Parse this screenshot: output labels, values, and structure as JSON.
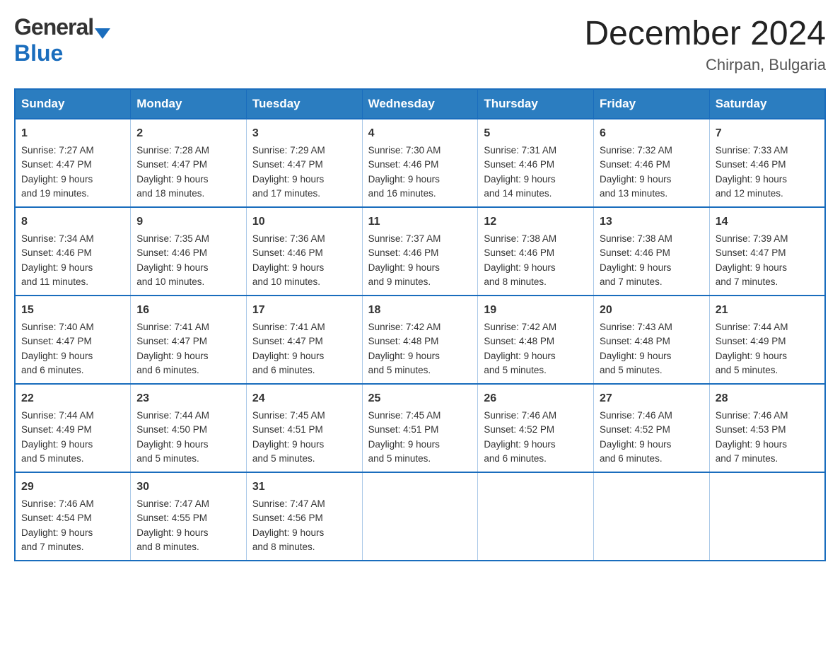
{
  "header": {
    "logo_general": "General",
    "logo_blue": "Blue",
    "month_title": "December 2024",
    "location": "Chirpan, Bulgaria"
  },
  "days_of_week": [
    "Sunday",
    "Monday",
    "Tuesday",
    "Wednesday",
    "Thursday",
    "Friday",
    "Saturday"
  ],
  "weeks": [
    [
      {
        "day": "1",
        "sunrise": "7:27 AM",
        "sunset": "4:47 PM",
        "daylight": "9 hours and 19 minutes."
      },
      {
        "day": "2",
        "sunrise": "7:28 AM",
        "sunset": "4:47 PM",
        "daylight": "9 hours and 18 minutes."
      },
      {
        "day": "3",
        "sunrise": "7:29 AM",
        "sunset": "4:47 PM",
        "daylight": "9 hours and 17 minutes."
      },
      {
        "day": "4",
        "sunrise": "7:30 AM",
        "sunset": "4:46 PM",
        "daylight": "9 hours and 16 minutes."
      },
      {
        "day": "5",
        "sunrise": "7:31 AM",
        "sunset": "4:46 PM",
        "daylight": "9 hours and 14 minutes."
      },
      {
        "day": "6",
        "sunrise": "7:32 AM",
        "sunset": "4:46 PM",
        "daylight": "9 hours and 13 minutes."
      },
      {
        "day": "7",
        "sunrise": "7:33 AM",
        "sunset": "4:46 PM",
        "daylight": "9 hours and 12 minutes."
      }
    ],
    [
      {
        "day": "8",
        "sunrise": "7:34 AM",
        "sunset": "4:46 PM",
        "daylight": "9 hours and 11 minutes."
      },
      {
        "day": "9",
        "sunrise": "7:35 AM",
        "sunset": "4:46 PM",
        "daylight": "9 hours and 10 minutes."
      },
      {
        "day": "10",
        "sunrise": "7:36 AM",
        "sunset": "4:46 PM",
        "daylight": "9 hours and 10 minutes."
      },
      {
        "day": "11",
        "sunrise": "7:37 AM",
        "sunset": "4:46 PM",
        "daylight": "9 hours and 9 minutes."
      },
      {
        "day": "12",
        "sunrise": "7:38 AM",
        "sunset": "4:46 PM",
        "daylight": "9 hours and 8 minutes."
      },
      {
        "day": "13",
        "sunrise": "7:38 AM",
        "sunset": "4:46 PM",
        "daylight": "9 hours and 7 minutes."
      },
      {
        "day": "14",
        "sunrise": "7:39 AM",
        "sunset": "4:47 PM",
        "daylight": "9 hours and 7 minutes."
      }
    ],
    [
      {
        "day": "15",
        "sunrise": "7:40 AM",
        "sunset": "4:47 PM",
        "daylight": "9 hours and 6 minutes."
      },
      {
        "day": "16",
        "sunrise": "7:41 AM",
        "sunset": "4:47 PM",
        "daylight": "9 hours and 6 minutes."
      },
      {
        "day": "17",
        "sunrise": "7:41 AM",
        "sunset": "4:47 PM",
        "daylight": "9 hours and 6 minutes."
      },
      {
        "day": "18",
        "sunrise": "7:42 AM",
        "sunset": "4:48 PM",
        "daylight": "9 hours and 5 minutes."
      },
      {
        "day": "19",
        "sunrise": "7:42 AM",
        "sunset": "4:48 PM",
        "daylight": "9 hours and 5 minutes."
      },
      {
        "day": "20",
        "sunrise": "7:43 AM",
        "sunset": "4:48 PM",
        "daylight": "9 hours and 5 minutes."
      },
      {
        "day": "21",
        "sunrise": "7:44 AM",
        "sunset": "4:49 PM",
        "daylight": "9 hours and 5 minutes."
      }
    ],
    [
      {
        "day": "22",
        "sunrise": "7:44 AM",
        "sunset": "4:49 PM",
        "daylight": "9 hours and 5 minutes."
      },
      {
        "day": "23",
        "sunrise": "7:44 AM",
        "sunset": "4:50 PM",
        "daylight": "9 hours and 5 minutes."
      },
      {
        "day": "24",
        "sunrise": "7:45 AM",
        "sunset": "4:51 PM",
        "daylight": "9 hours and 5 minutes."
      },
      {
        "day": "25",
        "sunrise": "7:45 AM",
        "sunset": "4:51 PM",
        "daylight": "9 hours and 5 minutes."
      },
      {
        "day": "26",
        "sunrise": "7:46 AM",
        "sunset": "4:52 PM",
        "daylight": "9 hours and 6 minutes."
      },
      {
        "day": "27",
        "sunrise": "7:46 AM",
        "sunset": "4:52 PM",
        "daylight": "9 hours and 6 minutes."
      },
      {
        "day": "28",
        "sunrise": "7:46 AM",
        "sunset": "4:53 PM",
        "daylight": "9 hours and 7 minutes."
      }
    ],
    [
      {
        "day": "29",
        "sunrise": "7:46 AM",
        "sunset": "4:54 PM",
        "daylight": "9 hours and 7 minutes."
      },
      {
        "day": "30",
        "sunrise": "7:47 AM",
        "sunset": "4:55 PM",
        "daylight": "9 hours and 8 minutes."
      },
      {
        "day": "31",
        "sunrise": "7:47 AM",
        "sunset": "4:56 PM",
        "daylight": "9 hours and 8 minutes."
      },
      null,
      null,
      null,
      null
    ]
  ],
  "labels": {
    "sunrise": "Sunrise:",
    "sunset": "Sunset:",
    "daylight": "Daylight:"
  }
}
